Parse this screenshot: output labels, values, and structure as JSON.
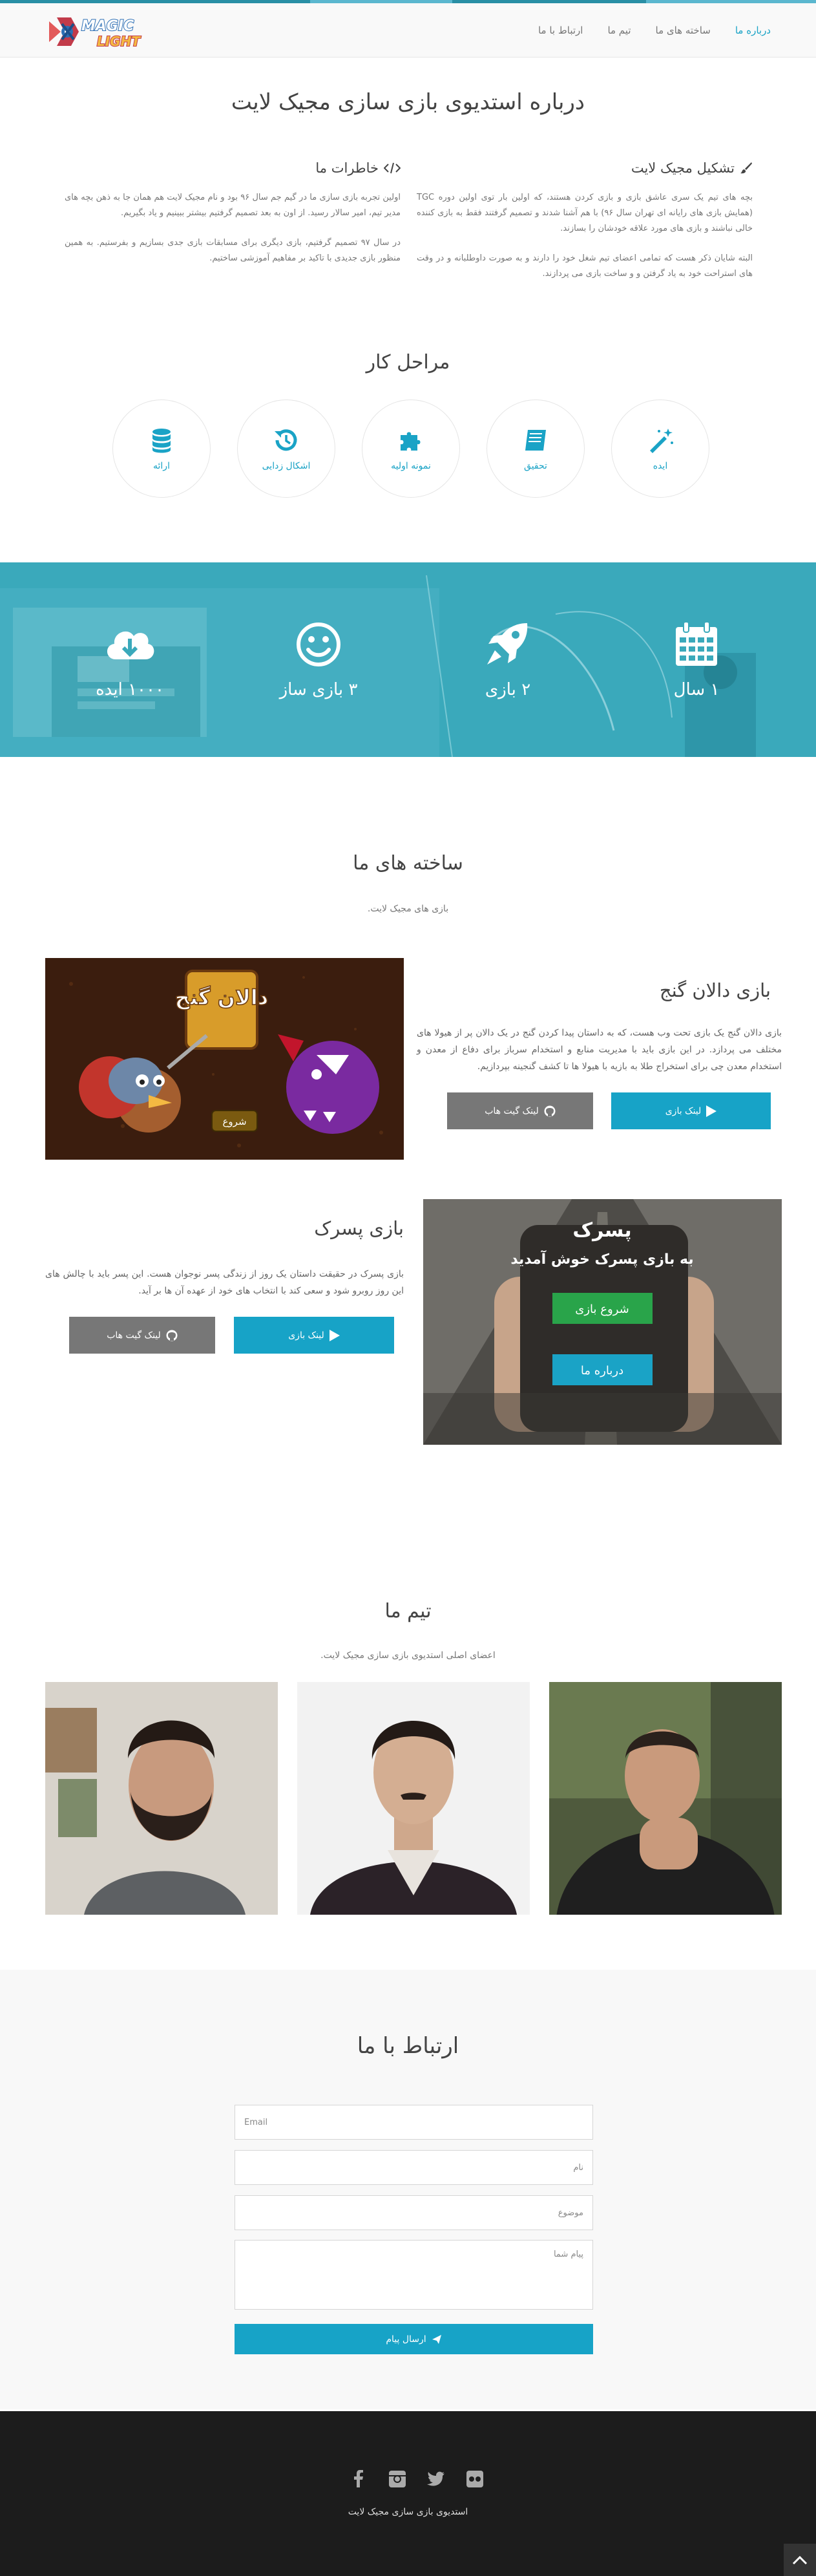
{
  "nav": {
    "logo_line1": "MAGIC",
    "logo_line2": "LIGHT",
    "links": [
      "درباره ما",
      "ساخته های ما",
      "تیم ما",
      "ارتباط با ما"
    ]
  },
  "about": {
    "title": "درباره استدیوی بازی سازی مجیک لایت",
    "col_right_title": "تشکیل مجیک لایت",
    "col_right_p1": "بچه های تیم یک سری عاشق بازی و بازی کردن هستند، که اولین بار توی اولین دوره TGC (همایش بازی های رایانه ای تهران سال ۹۶) با هم آشنا شدند و تصمیم گرفتند فقط به بازی کننده خالی نباشند و بازی های مورد علاقه خودشان را بسازند.",
    "col_right_p2": "البته شایان ذکر هست که تمامی اعضای تیم شغل خود را دارند و به صورت داوطلبانه و در وقت های استراحت خود به یاد گرفتن و و ساخت بازی می پردازند.",
    "col_left_title": "خاطرات ما",
    "col_left_p1": "اولین تجربه بازی سازی ما در گیم جم سال ۹۶ بود و نام مجیک لایت هم همان جا به ذهن بچه های مدیر تیم، امیر سالار رسید. از اون به بعد تصمیم گرفتیم بیشتر ببینیم و یاد بگیریم.",
    "col_left_p2": "در سال ۹۷ تصمیم گرفتیم، بازی دیگری برای مسابقات بازی جدی بسازیم و بفرستیم. به همین منظور بازی جدیدی با تاکید بر مفاهیم آموزشی ساختیم."
  },
  "process": {
    "title": "مراحل کار",
    "steps": [
      {
        "label": "ایده",
        "icon": "magic-wand-icon"
      },
      {
        "label": "تحقیق",
        "icon": "book-icon"
      },
      {
        "label": "نمونه اولیه",
        "icon": "puzzle-icon"
      },
      {
        "label": "اشکال زدایی",
        "icon": "history-icon"
      },
      {
        "label": "ارائه",
        "icon": "database-icon"
      }
    ]
  },
  "stats": [
    {
      "value": "۱ سال",
      "icon": "calendar-icon"
    },
    {
      "value": "۲ بازی",
      "icon": "rocket-icon"
    },
    {
      "value": "۳ بازی ساز",
      "icon": "smile-icon"
    },
    {
      "value": "۱۰۰۰ ایده",
      "icon": "cloud-download-icon"
    }
  ],
  "projects": {
    "title": "ساخته های ما",
    "subtitle": "بازی های مجیک لایت.",
    "items": [
      {
        "title": "بازی دالان گنج",
        "desc": "بازی دالان گنج یک بازی تحت وب هست، که به داستان پیدا کردن گنج در یک دالان پر از هیولا های مختلف می پردازد. در این بازی باید با مدیریت منابع و استخدام سرباز برای دفاع از معدن و استخدام معدن چی برای استخراج طلا به بازیه با هیولا ها تا کشف گنجینه بپردازیم.",
        "play_label": "لینک بازی",
        "github_label": "لینک گیت هاب",
        "image_title": "دالان گنج",
        "image_button": "شروع"
      },
      {
        "title": "بازی پسرک",
        "desc": "بازی پسرک در حقیقت داستان یک روز از زندگی پسر نوجوان هست. این پسر باید با چالش های این روز روبرو شود و سعی کند با انتخاب های خود از عهده آن ها بر آید.",
        "play_label": "لینک بازی",
        "github_label": "لینک گیت هاب",
        "image_title": "پسرک",
        "image_welcome": "به بازی پسرک خوش آمدید",
        "image_start": "شروع بازی",
        "image_about": "درباره ما"
      }
    ]
  },
  "team": {
    "title": "تیم ما",
    "subtitle": "اعضای اصلی استدیوی بازی سازی مجیک لایت."
  },
  "contact": {
    "title": "ارتباط با ما",
    "email_placeholder": "Email",
    "name_placeholder": "نام",
    "subject_placeholder": "موضوع",
    "message_placeholder": "پیام شما",
    "send_label": "ارسال پیام"
  },
  "footer": {
    "copyright": "استدیوی بازی سازی مجیک لایت",
    "social": [
      "facebook-icon",
      "instagram-icon",
      "twitter-icon",
      "flickr-icon"
    ]
  },
  "colors": {
    "accent": "#17a3c7",
    "stats_bg": "#3aa9bb",
    "footer_bg": "#1c1c1c",
    "github_btn": "#777777"
  }
}
